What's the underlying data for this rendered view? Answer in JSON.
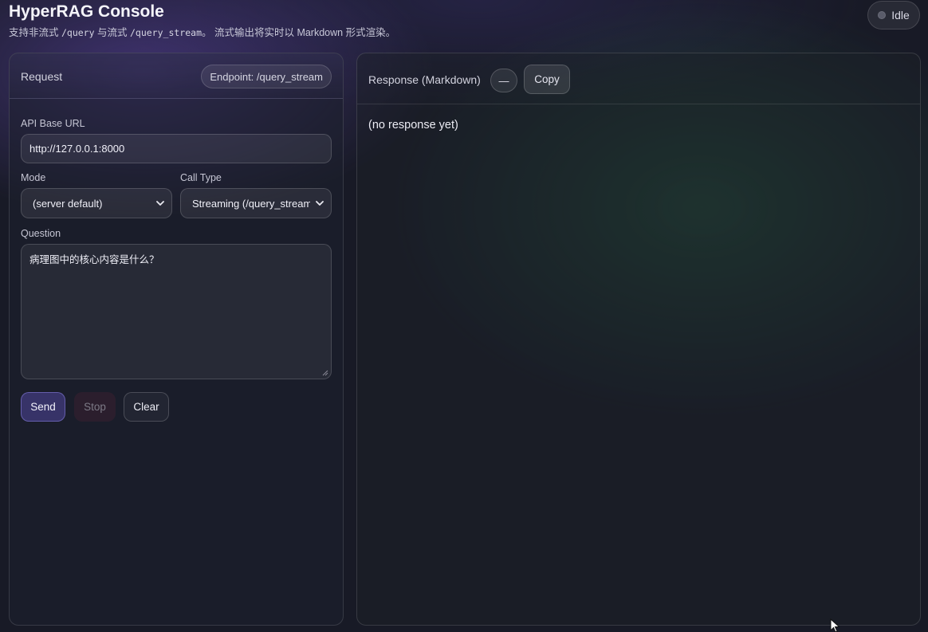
{
  "app": {
    "title": "HyperRAG Console",
    "subtitle_prefix": "支持非流式 ",
    "subtitle_code1": "/query",
    "subtitle_mid": " 与流式 ",
    "subtitle_code2": "/query_stream",
    "subtitle_suffix": "。 流式输出将实时以 Markdown 形式渲染。"
  },
  "status": {
    "label": "Idle",
    "color": "#5a5c6a"
  },
  "request_panel": {
    "title": "Request",
    "endpoint": "Endpoint: /query_stream",
    "api_base_url": {
      "label": "API Base URL",
      "value": "http://127.0.0.1:8000"
    },
    "mode": {
      "label": "Mode",
      "selected": "(server default)"
    },
    "call_type": {
      "label": "Call Type",
      "selected": "Streaming (/query_stream)"
    },
    "question": {
      "label": "Question",
      "value": "病理图中的核心内容是什么？"
    },
    "buttons": {
      "send": "Send",
      "stop": "Stop",
      "clear": "Clear"
    }
  },
  "response_panel": {
    "title": "Response (Markdown)",
    "dash_label": "—",
    "copy_label": "Copy",
    "body": "(no response yet)"
  },
  "colors": {
    "accent": "#5a50b4",
    "background": "#181a26"
  }
}
